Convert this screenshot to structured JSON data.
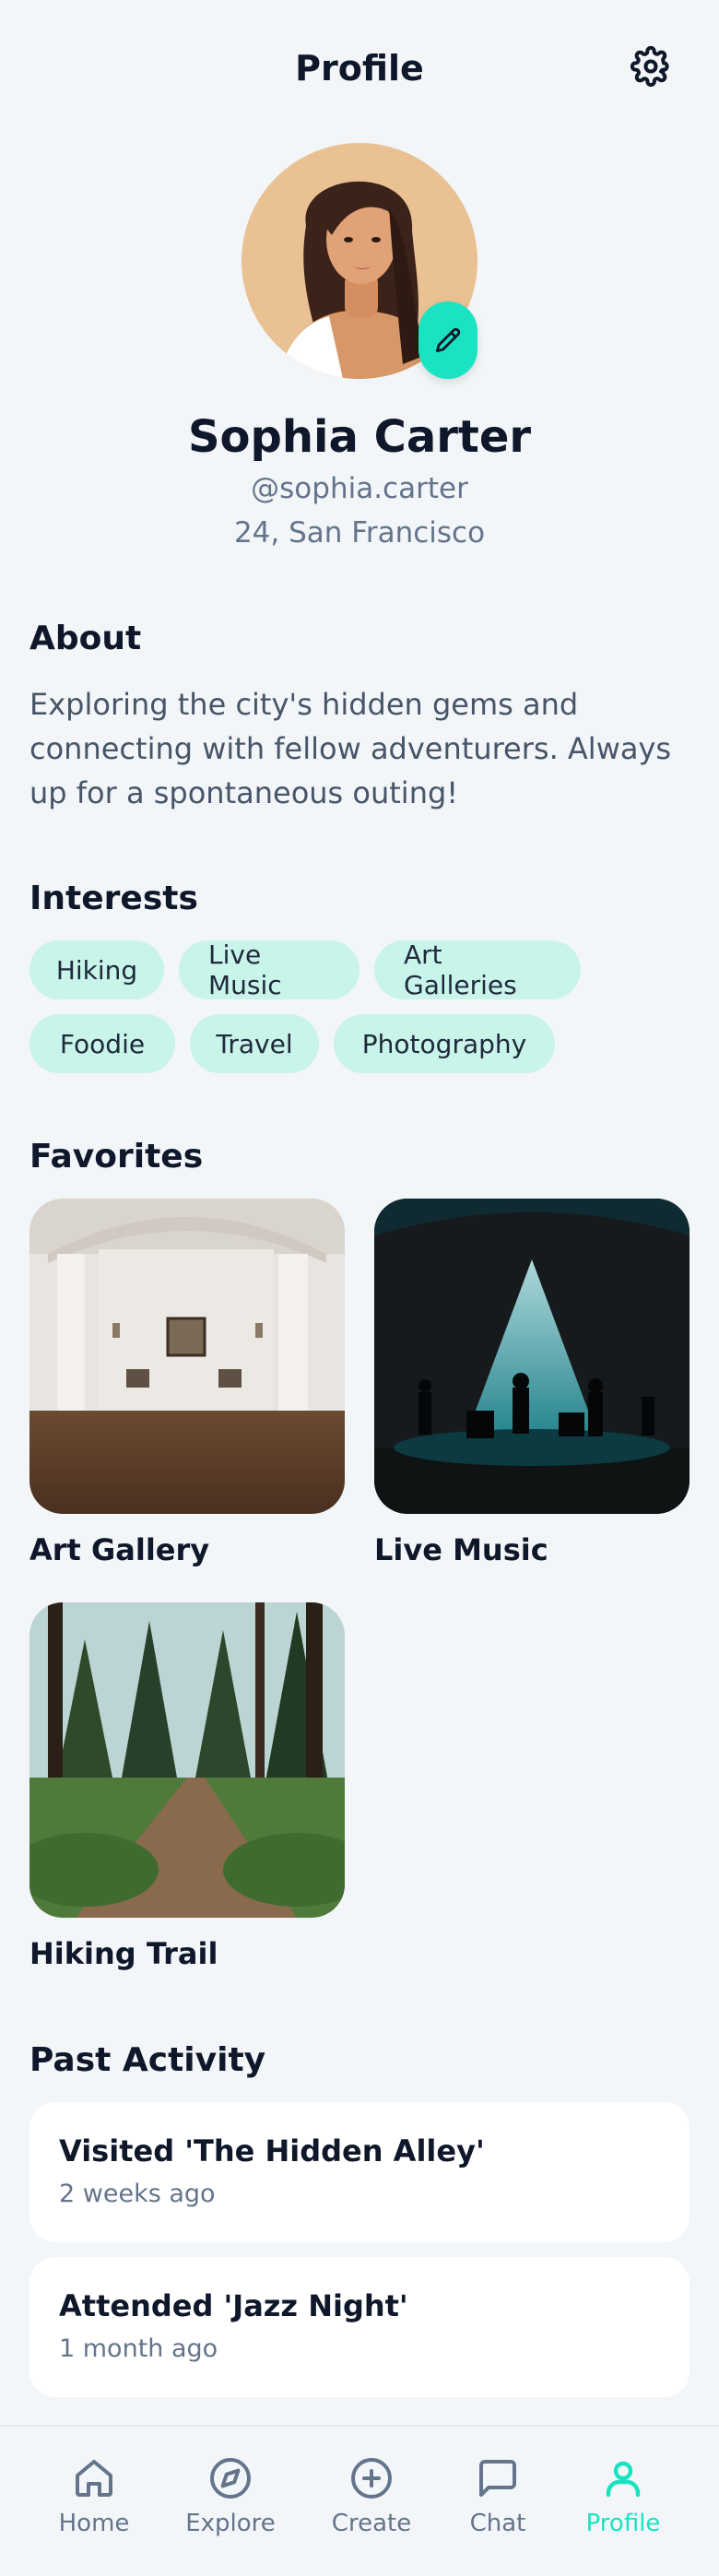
{
  "header": {
    "title": "Profile",
    "settings_icon": "gear-icon"
  },
  "profile": {
    "name": "Sophia Carter",
    "handle": "@sophia.carter",
    "location": "24, San Francisco",
    "edit_icon": "pencil-icon",
    "accent_color": "#19e3c0"
  },
  "about": {
    "title": "About",
    "text": "Exploring the city's hidden gems and connecting with fellow adventurers. Always up for a spontaneous outing!"
  },
  "interests": {
    "title": "Interests",
    "items": [
      "Hiking",
      "Live Music",
      "Art Galleries",
      "Foodie",
      "Travel",
      "Photography"
    ]
  },
  "favorites": {
    "title": "Favorites",
    "items": [
      {
        "label": "Art Gallery"
      },
      {
        "label": "Live Music"
      },
      {
        "label": "Hiking Trail"
      }
    ]
  },
  "activity": {
    "title": "Past Activity",
    "items": [
      {
        "title": "Visited 'The Hidden Alley'",
        "time": "2 weeks ago"
      },
      {
        "title": "Attended 'Jazz Night'",
        "time": "1 month ago"
      }
    ]
  },
  "nav": {
    "items": [
      {
        "label": "Home",
        "icon": "home-icon"
      },
      {
        "label": "Explore",
        "icon": "compass-icon"
      },
      {
        "label": "Create",
        "icon": "plus-circle-icon"
      },
      {
        "label": "Chat",
        "icon": "chat-icon"
      },
      {
        "label": "Profile",
        "icon": "user-icon",
        "active": true
      }
    ]
  }
}
